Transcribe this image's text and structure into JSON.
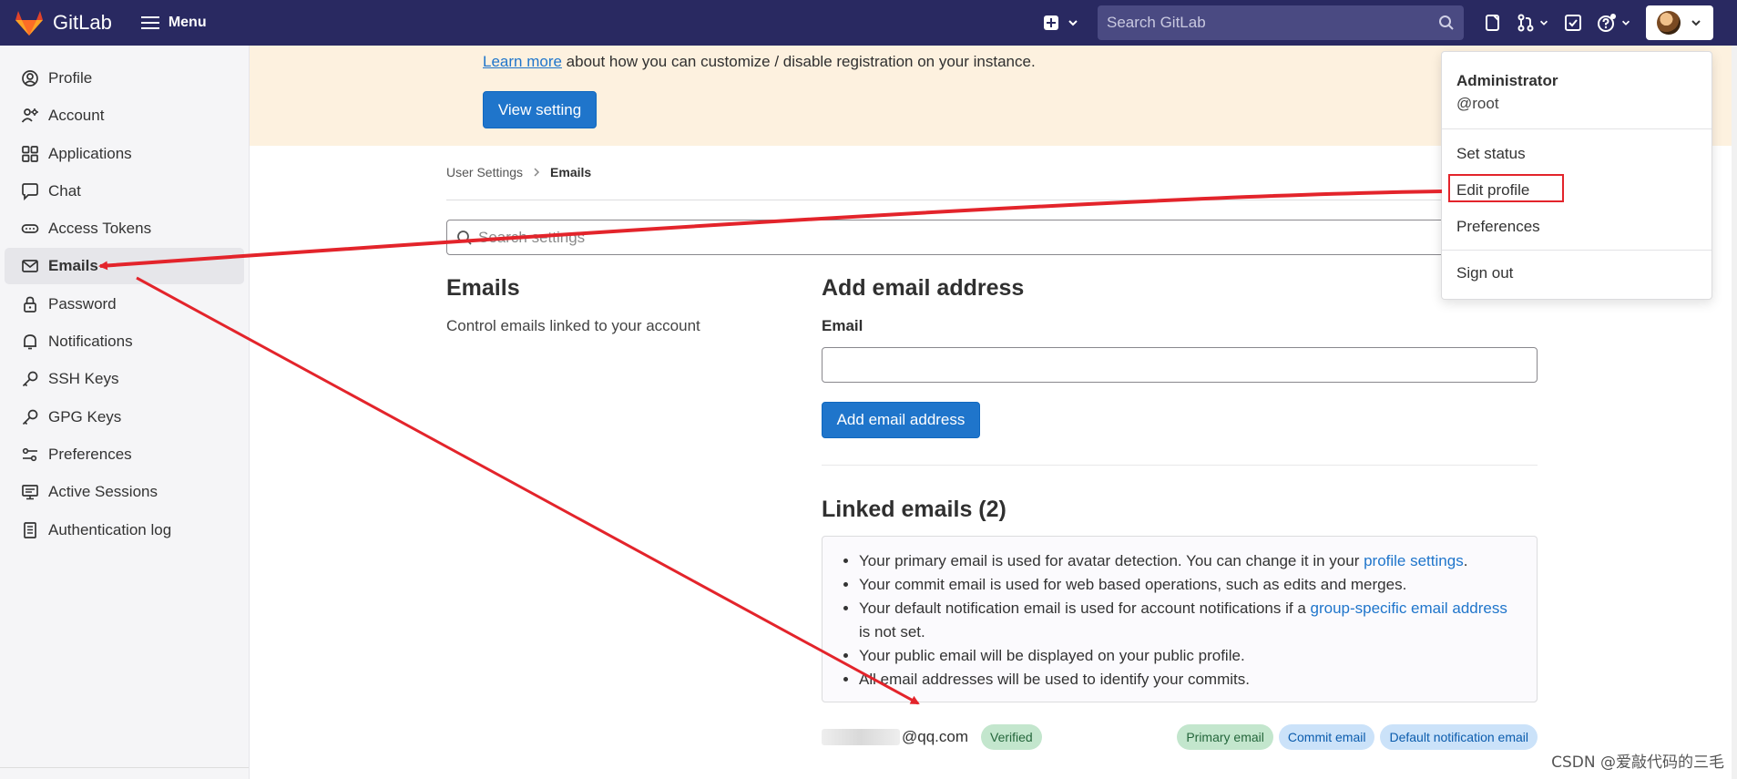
{
  "app": {
    "name": "GitLab"
  },
  "topbar": {
    "menu_label": "Menu",
    "search_placeholder": "Search GitLab",
    "icons": [
      "plus-square-icon",
      "chevron-down-icon",
      "issues-icon",
      "merge-request-icon",
      "todo-icon",
      "help-icon",
      "avatar"
    ]
  },
  "sidebar": {
    "items": [
      {
        "label": "Profile",
        "icon": "user-icon"
      },
      {
        "label": "Account",
        "icon": "account-icon"
      },
      {
        "label": "Applications",
        "icon": "applications-icon"
      },
      {
        "label": "Chat",
        "icon": "chat-icon"
      },
      {
        "label": "Access Tokens",
        "icon": "token-icon"
      },
      {
        "label": "Emails",
        "icon": "mail-icon",
        "active": true
      },
      {
        "label": "Password",
        "icon": "lock-icon"
      },
      {
        "label": "Notifications",
        "icon": "bell-icon"
      },
      {
        "label": "SSH Keys",
        "icon": "key-icon"
      },
      {
        "label": "GPG Keys",
        "icon": "key-icon"
      },
      {
        "label": "Preferences",
        "icon": "preferences-icon"
      },
      {
        "label": "Active Sessions",
        "icon": "monitor-icon"
      },
      {
        "label": "Authentication log",
        "icon": "log-icon"
      }
    ]
  },
  "banner": {
    "link_text": "Learn more",
    "text": " about how you can customize / disable registration on your instance.",
    "button_label": "View setting"
  },
  "breadcrumb": {
    "parent": "User Settings",
    "current": "Emails"
  },
  "settings_search": {
    "placeholder": "Search settings"
  },
  "section": {
    "title": "Emails",
    "description": "Control emails linked to your account"
  },
  "add_email": {
    "title": "Add email address",
    "field_label": "Email",
    "field_value": "",
    "button_label": "Add email address"
  },
  "linked": {
    "title": "Linked emails (2)",
    "info": {
      "line1_pre": "Your primary email is used for avatar detection. You can change it in your ",
      "line1_link": "profile settings",
      "line1_post": ".",
      "line2": "Your commit email is used for web based operations, such as edits and merges.",
      "line3_pre": "Your default notification email is used for account notifications if a ",
      "line3_link": "group-specific email address",
      "line3_post": " is not set.",
      "line4": "Your public email will be displayed on your public profile.",
      "line5": "All email addresses will be used to identify your commits."
    },
    "email_row": {
      "email_suffix": "@qq.com",
      "verified": "Verified",
      "badges": [
        "Primary email",
        "Commit email",
        "Default notification email"
      ]
    }
  },
  "dropdown": {
    "name": "Administrator",
    "username": "@root",
    "items": [
      "Set status",
      "Edit profile",
      "Preferences",
      "Sign out"
    ]
  },
  "watermark": "CSDN @爱敲代码的三毛",
  "colors": {
    "topbar": "#292961",
    "primary": "#1f75cb",
    "annotation": "#e3242b",
    "banner": "#fdf1df"
  }
}
